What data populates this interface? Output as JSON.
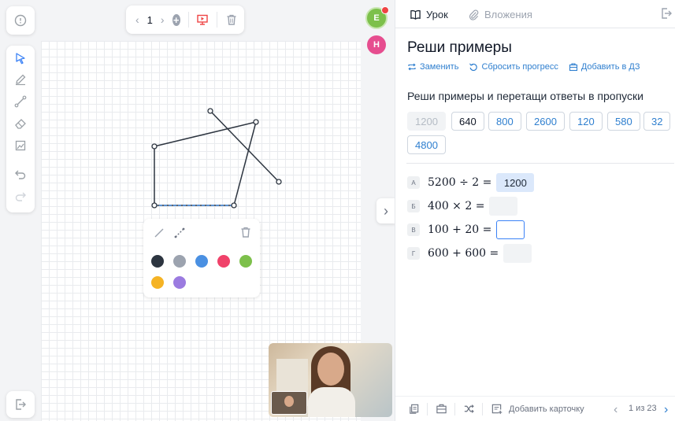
{
  "toolbar_top": {
    "page_number": "1"
  },
  "participants": [
    {
      "initial": "E",
      "color": "#7dc04b"
    },
    {
      "initial": "H",
      "color": "#e64d8f"
    }
  ],
  "left_tools": [
    "select-icon",
    "pencil-icon",
    "line-icon",
    "eraser-icon",
    "image-icon",
    "undo-icon",
    "redo-icon"
  ],
  "shape_colors": [
    "#2d3540",
    "#9ca3af",
    "#4a90e2",
    "#f0426a",
    "#7dc04b",
    "#f5b324",
    "#9b7be0"
  ],
  "tabs": {
    "lesson": "Урок",
    "attachments": "Вложения"
  },
  "lesson": {
    "title": "Реши примеры",
    "actions": {
      "replace": "Заменить",
      "reset": "Сбросить прогресс",
      "add_homework": "Добавить в ДЗ"
    },
    "task": "Реши примеры и перетащи ответы в пропуски",
    "answers": [
      "1200",
      "640",
      "800",
      "2600",
      "120",
      "580",
      "32",
      "4800"
    ],
    "equations": [
      {
        "letter": "А",
        "expr": "5200 ÷ 2 =",
        "answer": "1200"
      },
      {
        "letter": "Б",
        "expr": "400 × 2 =",
        "answer": ""
      },
      {
        "letter": "В",
        "expr": "100 + 20 =",
        "answer": ""
      },
      {
        "letter": "Г",
        "expr": "600 + 600 =",
        "answer": ""
      }
    ]
  },
  "bottom": {
    "add_card": "Добавить карточку",
    "page_count": "1 из 23"
  },
  "accent": "#2f7fcf"
}
